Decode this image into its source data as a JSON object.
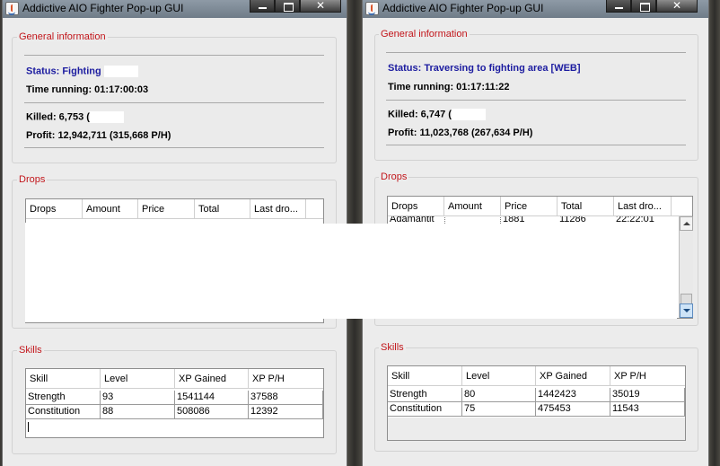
{
  "left_window": {
    "title": "Addictive AIO Fighter Pop-up GUI",
    "general": {
      "title": "General information",
      "status": "Status: Fighting",
      "time": "Time running: 01:17:00:03",
      "killed": "Killed: 6,753 (",
      "profit": "Profit: 12,942,711 (315,668 P/H)"
    },
    "drops": {
      "title": "Drops",
      "columns": [
        "Drops",
        "Amount",
        "Price",
        "Total",
        "Last dro..."
      ]
    },
    "skills": {
      "title": "Skills",
      "columns": [
        "Skill",
        "Level",
        "XP Gained",
        "XP P/H"
      ],
      "rows": [
        [
          "Strength",
          "93",
          "1541144",
          "37588"
        ],
        [
          "Constitution",
          "88",
          "508086",
          "12392"
        ]
      ]
    }
  },
  "right_window": {
    "title": "Addictive AIO Fighter Pop-up GUI",
    "general": {
      "title": "General information",
      "status": "Status: Traversing to fighting area [WEB]",
      "time": "Time running: 01:17:11:22",
      "killed": "Killed: 6,747 (",
      "profit": "Profit: 11,023,768 (267,634 P/H)"
    },
    "drops": {
      "title": "Drops",
      "columns": [
        "Drops",
        "Amount",
        "Price",
        "Total",
        "Last dro..."
      ],
      "partial_row": [
        "Adamantit",
        "",
        "1881",
        "11286",
        "22:22:01"
      ]
    },
    "skills": {
      "title": "Skills",
      "columns": [
        "Skill",
        "Level",
        "XP Gained",
        "XP P/H"
      ],
      "rows": [
        [
          "Strength",
          "80",
          "1442423",
          "35019"
        ],
        [
          "Constitution",
          "75",
          "475453",
          "11543"
        ]
      ]
    }
  }
}
